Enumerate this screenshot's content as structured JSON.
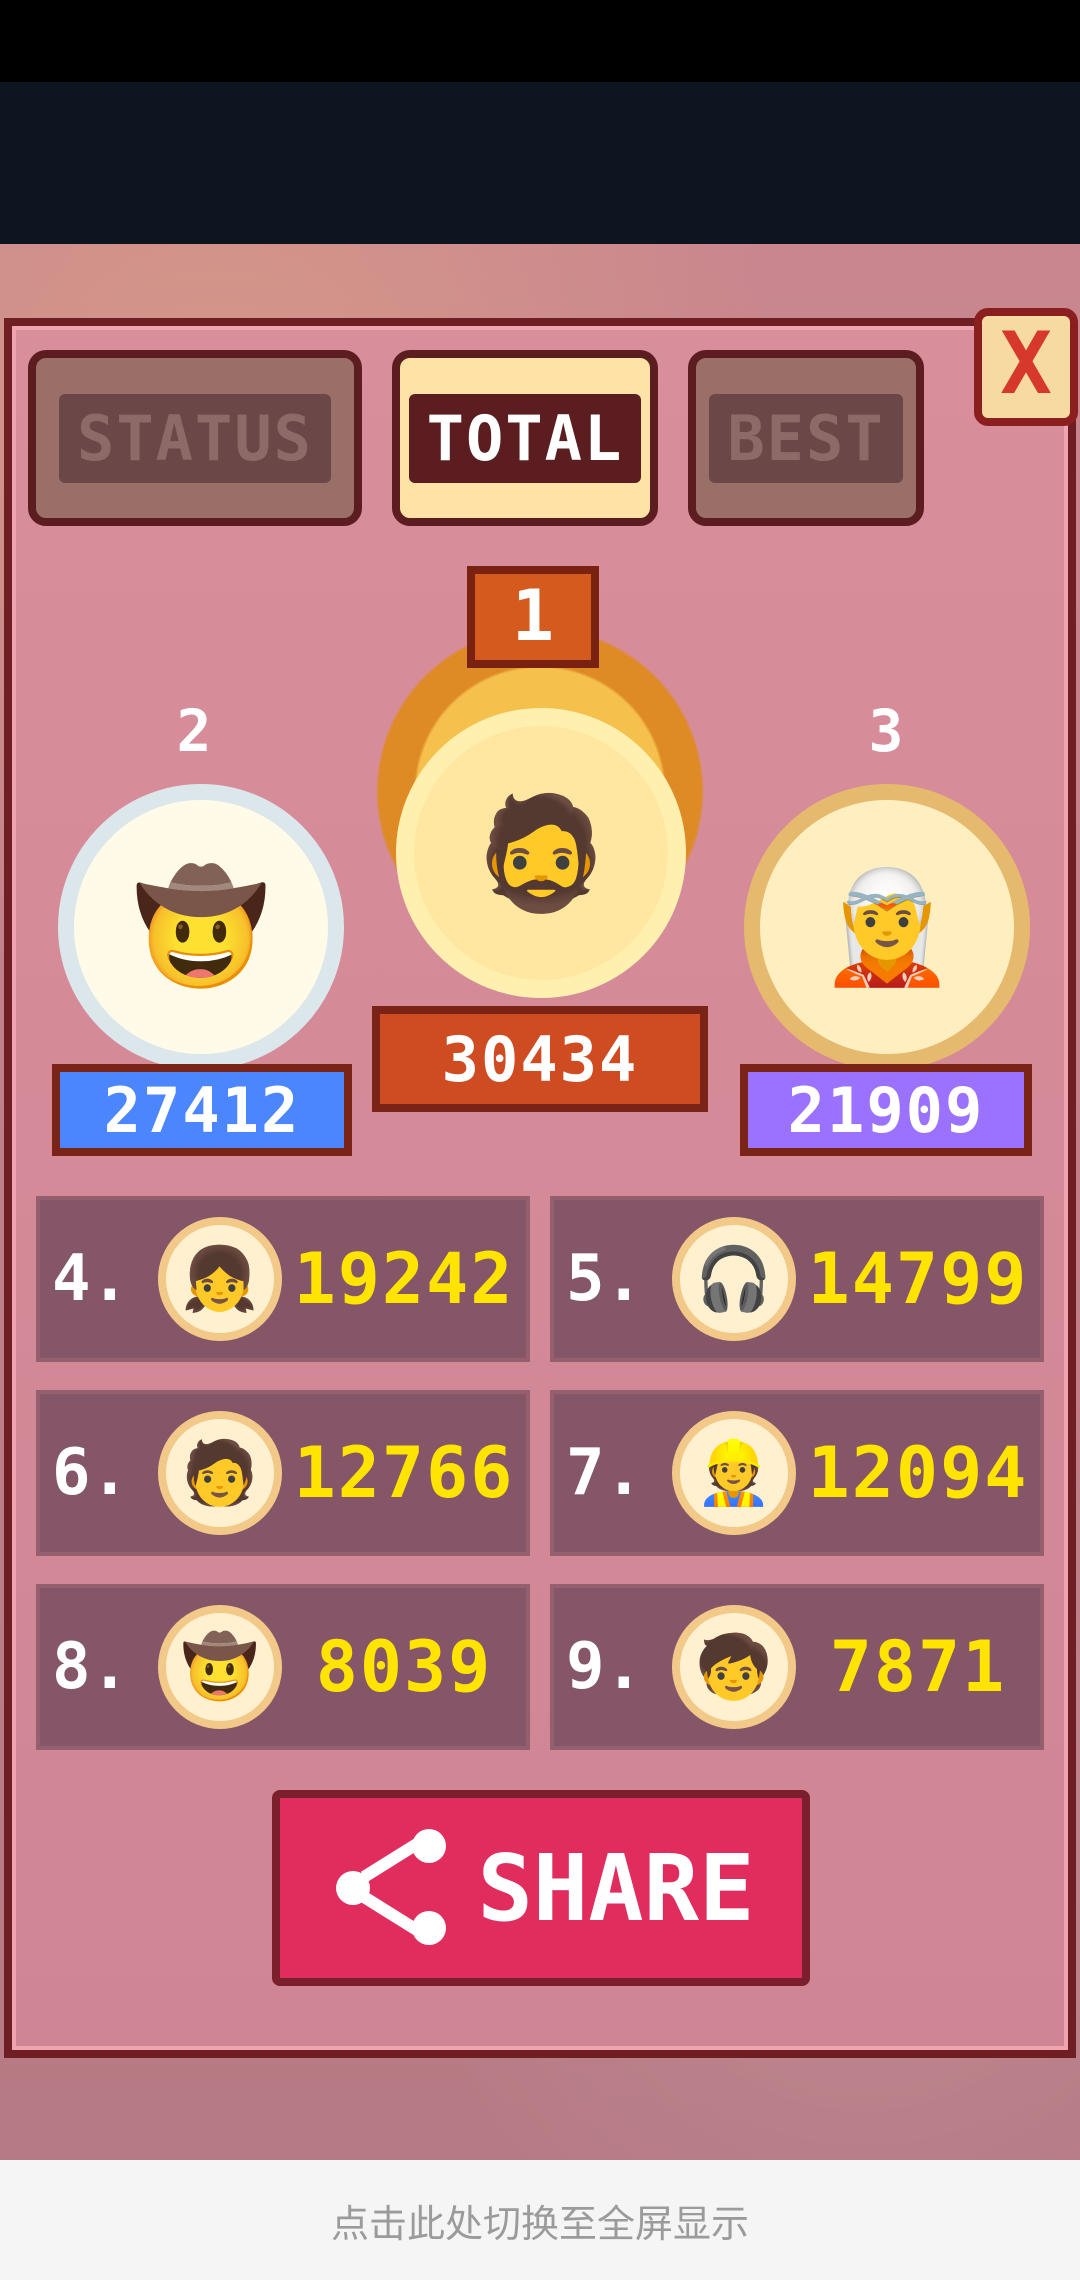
{
  "tabs": {
    "status": "STATUS",
    "total": "TOTAL",
    "best": "BEST"
  },
  "close_label": "X",
  "podium": {
    "first": {
      "rank": "1",
      "score": "30434",
      "avatar_icon": "bearded-man-avatar"
    },
    "second": {
      "rank": "2",
      "score": "27412",
      "avatar_icon": "cowboy-avatar"
    },
    "third": {
      "rank": "3",
      "score": "21909",
      "avatar_icon": "green-hat-elf-avatar"
    }
  },
  "rankings": [
    {
      "rank": "4.",
      "score": "19242",
      "avatar_icon": "redhead-girl-avatar"
    },
    {
      "rank": "5.",
      "score": "14799",
      "avatar_icon": "headphones-girl-avatar"
    },
    {
      "rank": "6.",
      "score": "12766",
      "avatar_icon": "blue-hat-boy-avatar"
    },
    {
      "rank": "7.",
      "score": "12094",
      "avatar_icon": "hardhat-worker-avatar"
    },
    {
      "rank": "8.",
      "score": "8039",
      "avatar_icon": "hatted-gunslinger-avatar"
    },
    {
      "rank": "9.",
      "score": "7871",
      "avatar_icon": "blue-cap-kid-avatar"
    }
  ],
  "share_label": "SHARE",
  "bottom_text": "点击此处切换至全屏显示",
  "colors": {
    "accent": "#e12c5e",
    "gold": "#ffe400",
    "panel": "#d98e9b"
  }
}
